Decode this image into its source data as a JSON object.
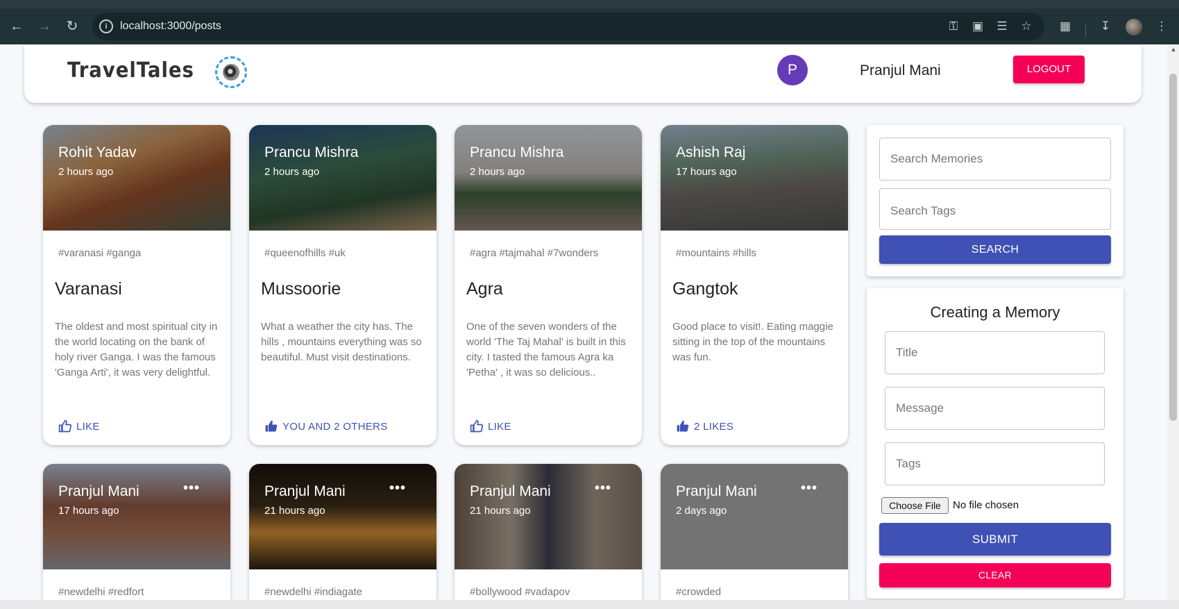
{
  "browser": {
    "url": "localhost:3000/posts",
    "back_icon": "arrow-left",
    "forward_icon": "arrow-right",
    "reload_icon": "reload",
    "toolbar_icons": [
      "key-icon",
      "install-icon",
      "translate-icon",
      "star-icon",
      "extensions-icon",
      "download-icon",
      "profile-icon",
      "menu-icon"
    ]
  },
  "header": {
    "brand": "TravelTales",
    "avatar_letter": "P",
    "username": "Pranjul Mani",
    "logout_label": "LOGOUT",
    "accent_color": "#f50057",
    "avatar_color": "#673ab7"
  },
  "posts": [
    {
      "author": "Rohit Yadav",
      "time": "2 hours ago",
      "tags": "#varanasi #ganga",
      "title": "Varanasi",
      "message": "The oldest and most spiritual city in the world locating on the bank of holy river Ganga. I was the famous 'Ganga Arti', it was very delightful.",
      "like": "LIKE",
      "liked": false
    },
    {
      "author": "Prancu Mishra",
      "time": "2 hours ago",
      "tags": "#queenofhills #uk",
      "title": "Mussoorie",
      "message": "What a weather the city has. The hills , mountains everything was so beautiful. Must visit destinations.",
      "like": "YOU AND 2 OTHERS",
      "liked": true
    },
    {
      "author": "Prancu Mishra",
      "time": "2 hours ago",
      "tags": "#agra #tajmahal #7wonders",
      "title": "Agra",
      "message": "One of the seven wonders of the world 'The Taj Mahal' is built in this city. I tasted the famous Agra ka 'Petha' , it was so delicious..",
      "like": "LIKE",
      "liked": false
    },
    {
      "author": "Ashish Raj",
      "time": "17 hours ago",
      "tags": "#mountains #hills",
      "title": "Gangtok",
      "message": "Good place to visit!. Eating maggie sitting in the top of the mountains was fun.",
      "like": "2 LIKES",
      "liked": true
    },
    {
      "author": "Pranjul Mani",
      "time": "17 hours ago",
      "tags": "#newdelhi #redfort",
      "more": "•••"
    },
    {
      "author": "Pranjul Mani",
      "time": "21 hours ago",
      "tags": "#newdelhi #indiagate",
      "more": "•••"
    },
    {
      "author": "Pranjul Mani",
      "time": "21 hours ago",
      "tags": "#bollywood #vadapov",
      "more": "•••"
    },
    {
      "author": "Pranjul Mani",
      "time": "2 days ago",
      "tags": "#crowded",
      "more": "•••"
    }
  ],
  "search": {
    "memories_placeholder": "Search Memories",
    "tags_placeholder": "Search Tags",
    "button": "SEARCH"
  },
  "form": {
    "heading": "Creating a Memory",
    "title_placeholder": "Title",
    "message_placeholder": "Message",
    "tags_placeholder": "Tags",
    "file_button": "Choose File",
    "file_status": "No file chosen",
    "submit": "SUBMIT",
    "clear": "CLEAR",
    "primary_color": "#3f51b5"
  }
}
